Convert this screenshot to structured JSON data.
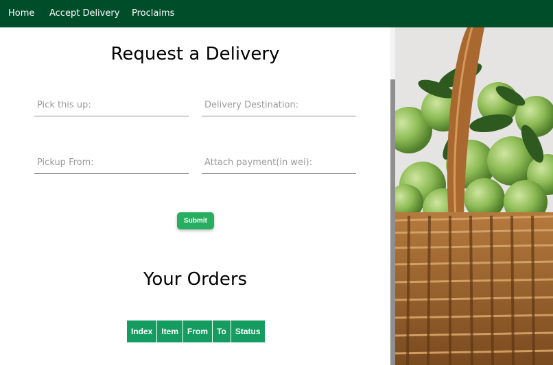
{
  "nav": {
    "items": [
      {
        "label": "Home"
      },
      {
        "label": "Accept Delivery"
      },
      {
        "label": "Proclaims"
      }
    ]
  },
  "form": {
    "title": "Request a Delivery",
    "fields": [
      {
        "placeholder": "Pick this up:",
        "value": ""
      },
      {
        "placeholder": "Delivery Destination:",
        "value": ""
      },
      {
        "placeholder": "Pickup From:",
        "value": ""
      },
      {
        "placeholder": "Attach payment(in wei):",
        "value": ""
      }
    ],
    "submit_label": "Submit"
  },
  "orders": {
    "title": "Your Orders",
    "columns": [
      "Index",
      "Item",
      "From",
      "To",
      "Status"
    ],
    "rows": []
  },
  "image": {
    "subject": "basket-of-green-apples"
  },
  "colors": {
    "navbar": "#004d2a",
    "accent": "#27ae60",
    "table_header": "#159d61"
  }
}
